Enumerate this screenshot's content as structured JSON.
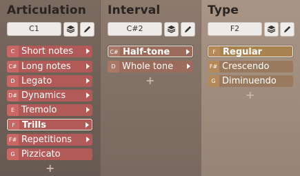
{
  "colors": {
    "articulation_row": "#b25a58",
    "interval_row": "#9b6b5c",
    "type_row": "#9a7a5e",
    "selected_border": "#f4efe9"
  },
  "columns": [
    {
      "title": "Articulation",
      "key": "C1",
      "tools": [
        "layers-icon",
        "pencil-icon"
      ],
      "add_symbol": "+",
      "items": [
        {
          "key": "C",
          "label": "Short notes"
        },
        {
          "key": "C#",
          "label": "Long notes"
        },
        {
          "key": "D",
          "label": "Legato"
        },
        {
          "key": "D#",
          "label": "Dynamics"
        },
        {
          "key": "E",
          "label": "Tremolo"
        },
        {
          "key": "F",
          "label": "Trills",
          "selected": true
        },
        {
          "key": "F#",
          "label": "Repetitions"
        },
        {
          "key": "G",
          "label": "Pizzicato"
        }
      ]
    },
    {
      "title": "Interval",
      "key": "C#2",
      "tools": [
        "layers-icon",
        "pencil-icon"
      ],
      "add_symbol": "+",
      "items": [
        {
          "key": "C#",
          "label": "Half-tone",
          "selected": true
        },
        {
          "key": "D",
          "label": "Whole tone"
        }
      ]
    },
    {
      "title": "Type",
      "key": "F2",
      "tools": [
        "layers-icon",
        "pencil-icon"
      ],
      "add_symbol": "+",
      "items": [
        {
          "key": "F",
          "label": "Regular",
          "selected": true
        },
        {
          "key": "F#",
          "label": "Crescendo"
        },
        {
          "key": "G",
          "label": "Diminuendo"
        }
      ]
    }
  ]
}
